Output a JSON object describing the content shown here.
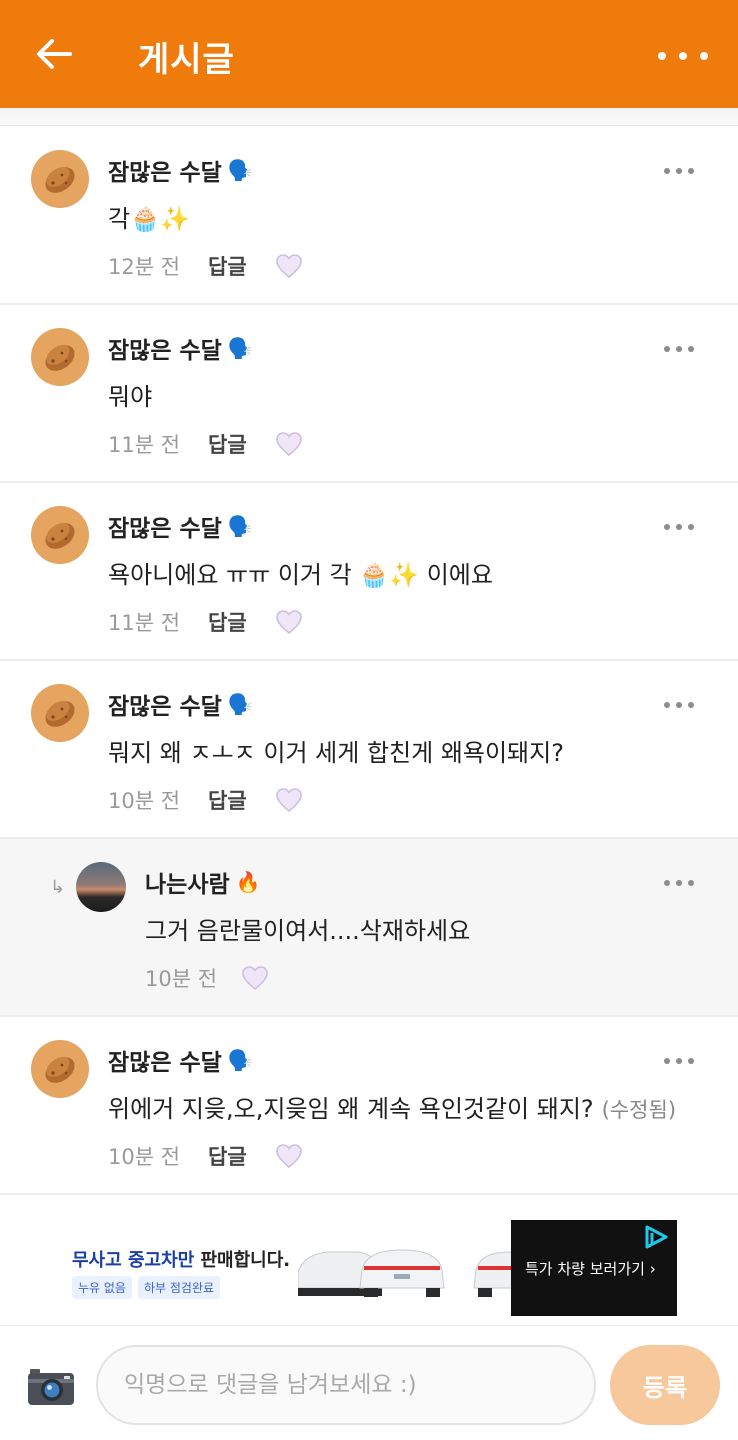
{
  "header": {
    "title": "게시글",
    "back_icon": "arrow-left-icon",
    "more_icon": "more-horizontal-icon"
  },
  "colors": {
    "brand": "#ee7b0b",
    "submit": "#f6c89b"
  },
  "comments": [
    {
      "name": "잠많은 수달",
      "badge": "🗣️",
      "text": "각🧁✨",
      "edited": "",
      "time": "12분 전",
      "reply_label": "답글",
      "is_reply": false
    },
    {
      "name": "잠많은 수달",
      "badge": "🗣️",
      "text": "뭐야",
      "edited": "",
      "time": "11분 전",
      "reply_label": "답글",
      "is_reply": false
    },
    {
      "name": "잠많은 수달",
      "badge": "🗣️",
      "text": "욕아니에요 ㅠㅠ 이거 각 🧁✨ 이에요",
      "edited": "",
      "time": "11분 전",
      "reply_label": "답글",
      "is_reply": false
    },
    {
      "name": "잠많은 수달",
      "badge": "🗣️",
      "text": "뭐지 왜 ㅈㅗㅈ 이거 세게 합친게 왜욕이돼지?",
      "edited": "",
      "time": "10분 전",
      "reply_label": "답글",
      "is_reply": false
    },
    {
      "name": "나는사람",
      "badge": "🔥",
      "text": "그거 음란물이여서....삭재하세요",
      "edited": "",
      "time": "10분 전",
      "reply_label": "",
      "is_reply": true
    },
    {
      "name": "잠많은 수달",
      "badge": "🗣️",
      "text": "위에거 지읒,오,지읒임 왜 계속 욕인것같이 돼지?",
      "edited": "(수정됨)",
      "time": "10분 전",
      "reply_label": "답글",
      "is_reply": false
    }
  ],
  "ad": {
    "headline_blue": "무사고 중고차만",
    "headline_rest": " 판매합니다.",
    "tags": [
      "누유 없음",
      "하부 점검완료"
    ],
    "cta": "특가 차량 보러가기  ›"
  },
  "composer": {
    "placeholder": "익명으로 댓글을 남겨보세요 :)",
    "submit_label": "등록",
    "camera_icon": "camera-icon"
  }
}
